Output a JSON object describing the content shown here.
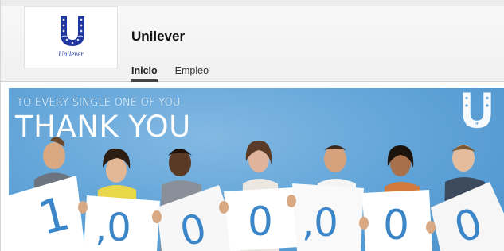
{
  "company": {
    "name": "Unilever",
    "logo_text": "Unilever"
  },
  "tabs": [
    {
      "label": "Inicio",
      "active": true
    },
    {
      "label": "Empleo",
      "active": false
    }
  ],
  "banner": {
    "subtitle": "TO EVERY SINGLE ONE OF YOU.",
    "title": "THANK YOU",
    "logo_text": "Unilever",
    "signs": [
      "1",
      ",0",
      "0",
      "0",
      ",0",
      "0",
      "0"
    ],
    "background": "#5ea2d7",
    "digit_color": "#3a86c8"
  }
}
